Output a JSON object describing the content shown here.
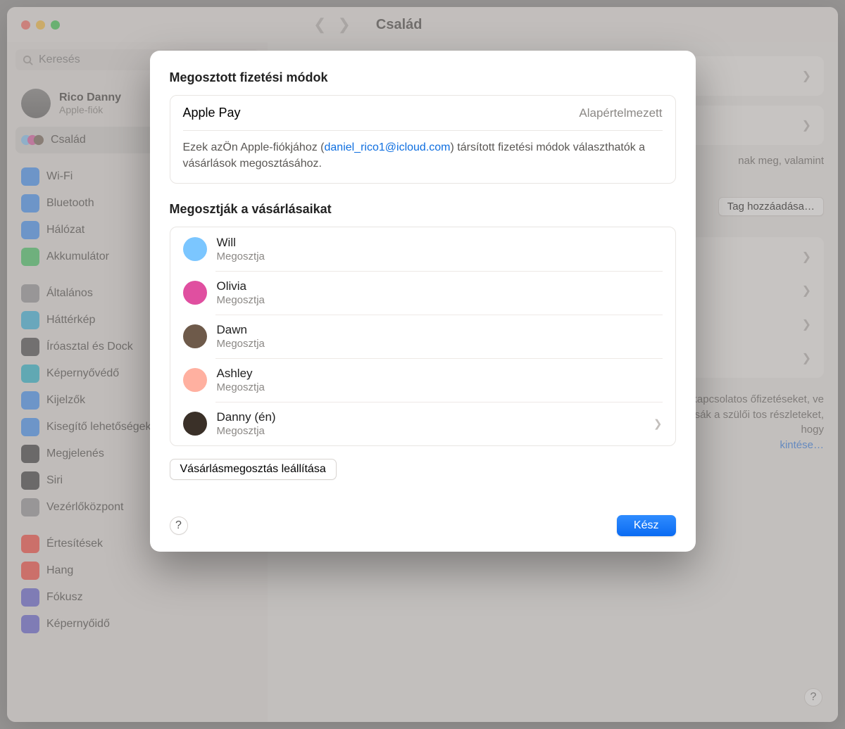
{
  "window": {
    "title": "Család",
    "search_placeholder": "Keresés"
  },
  "account": {
    "name": "Rico Danny",
    "sub": "Apple-fiók"
  },
  "sidebar": {
    "items": [
      {
        "label": "Család",
        "icon": "family",
        "color": "",
        "selected": true
      },
      {
        "label": "Wi-Fi",
        "icon": "wifi",
        "color": "#2f8cff"
      },
      {
        "label": "Bluetooth",
        "icon": "bt",
        "color": "#2f8cff"
      },
      {
        "label": "Hálózat",
        "icon": "net",
        "color": "#2f8cff"
      },
      {
        "label": "Akkumulátor",
        "icon": "batt",
        "color": "#34c759"
      },
      {
        "label": "Általános",
        "icon": "gear",
        "color": "#8e8e93"
      },
      {
        "label": "Háttérkép",
        "icon": "wall",
        "color": "#27b4e5"
      },
      {
        "label": "Íróasztal és Dock",
        "icon": "dock",
        "color": "#3b3b3d"
      },
      {
        "label": "Képernyővédő",
        "icon": "ss",
        "color": "#16b5d0"
      },
      {
        "label": "Kijelzők",
        "icon": "disp",
        "color": "#2f8cff"
      },
      {
        "label": "Kisegítő lehetőségek",
        "icon": "a11y",
        "color": "#2f8cff"
      },
      {
        "label": "Megjelenés",
        "icon": "appear",
        "color": "#2b2b2d"
      },
      {
        "label": "Siri",
        "icon": "siri",
        "color": "#2b2b2d"
      },
      {
        "label": "Vezérlőközpont",
        "icon": "cc",
        "color": "#8e8e93"
      },
      {
        "label": "Értesítések",
        "icon": "notif",
        "color": "#ff3b30"
      },
      {
        "label": "Hang",
        "icon": "sound",
        "color": "#ff3b30"
      },
      {
        "label": "Fókusz",
        "icon": "focus",
        "color": "#5856d6"
      },
      {
        "label": "Képernyőidő",
        "icon": "st",
        "color": "#5856d6"
      }
    ]
  },
  "main": {
    "bg_text1": "nak meg, valamint",
    "add_member": "Tag hozzáadása…",
    "bg_text2": "al kapcsolatos őfizetéseket, ve beállítsák a szülői tos részleteket, hogy",
    "bg_link": "kintése…"
  },
  "sheet": {
    "h_payment": "Megosztott fizetési módok",
    "payment_name": "Apple Pay",
    "payment_default": "Alapértelmezett",
    "note_prefix": "Ezek azÖn Apple-fiókjához (",
    "note_email": "daniel_rico1@icloud.com",
    "note_suffix": ") társított fizetési módok választhatók a vásárlások megosztásához.",
    "h_sharing": "Megosztják a vásárlásaikat",
    "members": [
      {
        "name": "Will",
        "status": "Megosztja",
        "color": "#7bc6ff",
        "chevron": false
      },
      {
        "name": "Olivia",
        "status": "Megosztja",
        "color": "#e04fa0",
        "chevron": false
      },
      {
        "name": "Dawn",
        "status": "Megosztja",
        "color": "#6e5a4a",
        "chevron": false
      },
      {
        "name": "Ashley",
        "status": "Megosztja",
        "color": "#ffb0a0",
        "chevron": false
      },
      {
        "name": "Danny (én)",
        "status": "Megosztja",
        "color": "#3a3028",
        "chevron": true
      }
    ],
    "stop_label": "Vásárlásmegosztás leállítása",
    "done_label": "Kész"
  }
}
